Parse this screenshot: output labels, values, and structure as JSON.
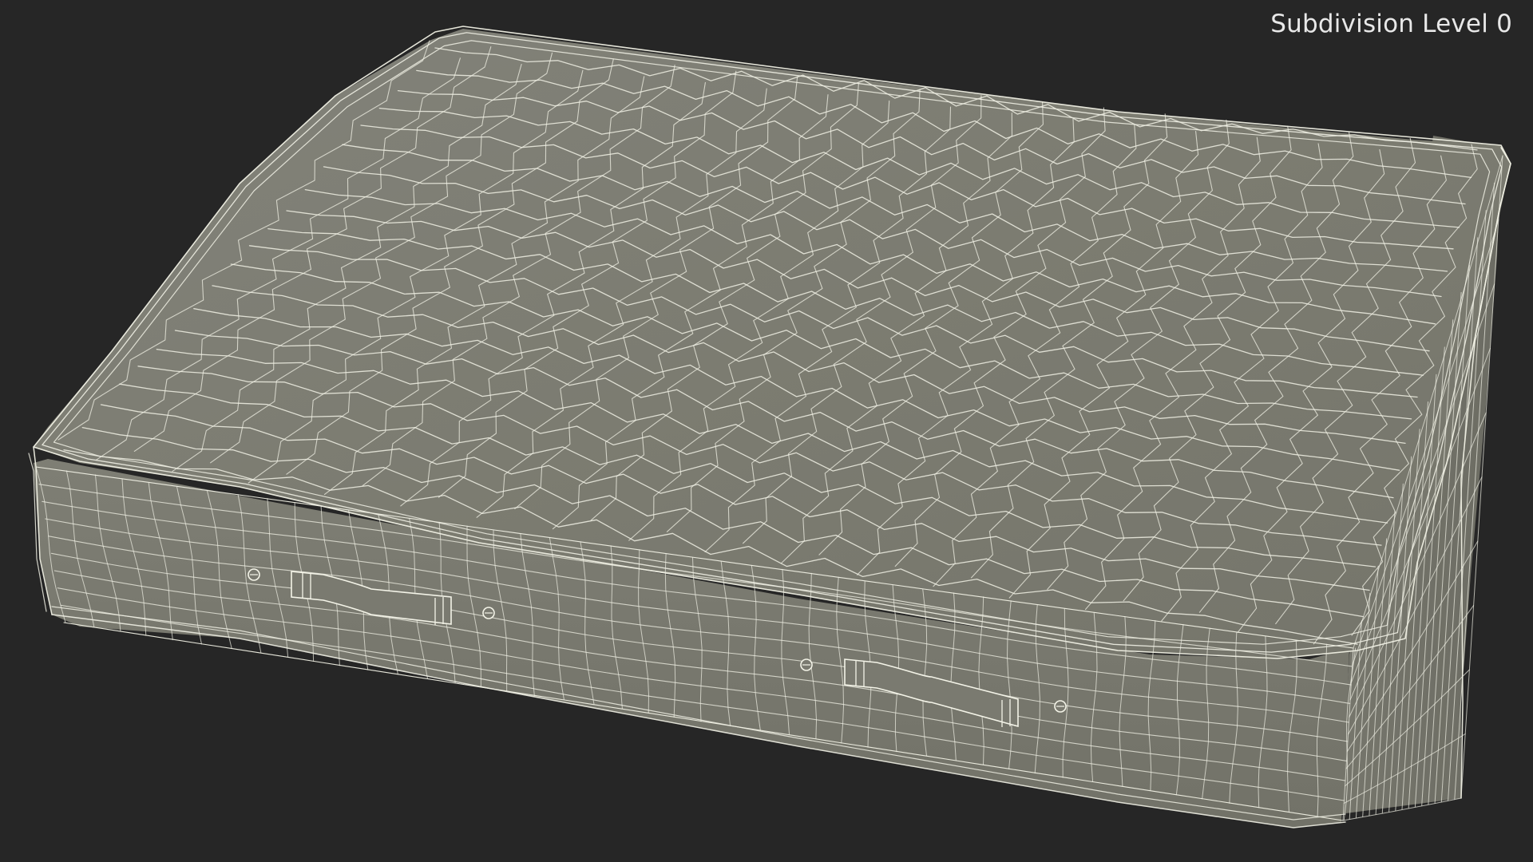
{
  "viewport": {
    "subdivision_label": "Subdivision Level 0"
  },
  "model": {
    "object": "mattress",
    "display_mode": "wireframe-on-shaded",
    "background_color": "#262626",
    "surface_color": "#808073",
    "wire_color": "#f2f2e6",
    "handles_visible": 2
  }
}
